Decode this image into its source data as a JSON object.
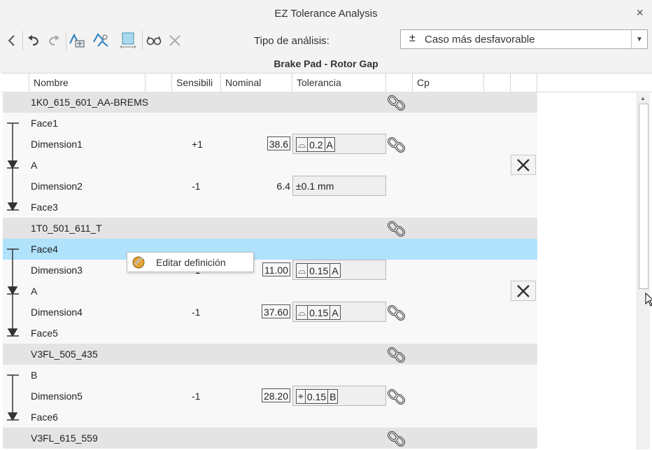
{
  "window": {
    "title": "EZ Tolerance Analysis",
    "close_glyph": "×"
  },
  "toolbar": {
    "icons": [
      "back-arrow-icon",
      "undo-icon",
      "redo-icon",
      "add-dimension-icon",
      "add-surface-icon",
      "cube-icon",
      "glasses-icon",
      "close-icon"
    ],
    "analysis_label": "Tipo de análisis:",
    "analysis_value": "Caso más desfavorable",
    "analysis_symbol": "±"
  },
  "analysis_title": "Brake Pad - Rotor Gap",
  "columns": [
    "Nombre",
    "Sensibili",
    "Nominal",
    "Tolerancia",
    "Cp"
  ],
  "rows": [
    {
      "type": "part",
      "name": "1K0_615_601_AA-BREMS",
      "link": true
    },
    {
      "type": "face",
      "name": "Face1"
    },
    {
      "type": "dim",
      "name": "Dimension1",
      "sens": "+1",
      "nominal": "38.6",
      "boxed": true,
      "tol": {
        "kind": "fcf",
        "sym": "⌓",
        "val": "0.2",
        "datum": "A"
      },
      "link": true
    },
    {
      "type": "face",
      "name": "A",
      "remove": true
    },
    {
      "type": "dim",
      "name": "Dimension2",
      "sens": "-1",
      "nominal": "6.4",
      "boxed": false,
      "tol": {
        "kind": "text",
        "text": "±0.1 mm"
      }
    },
    {
      "type": "face",
      "name": "Face3"
    },
    {
      "type": "part",
      "name": "1T0_501_611_T",
      "link": true
    },
    {
      "type": "face",
      "name": "Face4",
      "selected": true
    },
    {
      "type": "dim",
      "name": "Dimension3",
      "sens": "-1",
      "nominal": "11.00",
      "boxed": true,
      "tol": {
        "kind": "fcf",
        "sym": "⌓",
        "val": "0.15",
        "datum": "A"
      }
    },
    {
      "type": "face",
      "name": "A",
      "remove": true
    },
    {
      "type": "dim",
      "name": "Dimension4",
      "sens": "-1",
      "nominal": "37.60",
      "boxed": true,
      "tol": {
        "kind": "fcf",
        "sym": "⌓",
        "val": "0.15",
        "datum": "A"
      },
      "link": true
    },
    {
      "type": "face",
      "name": "Face5"
    },
    {
      "type": "part",
      "name": "V3FL_505_435",
      "link": true
    },
    {
      "type": "face",
      "name": "B"
    },
    {
      "type": "dim",
      "name": "Dimension5",
      "sens": "-1",
      "nominal": "28.20",
      "boxed": true,
      "tol": {
        "kind": "fcf",
        "sym": "⌖",
        "val": "0.15",
        "datum": "B"
      },
      "link": true
    },
    {
      "type": "face",
      "name": "Face6"
    },
    {
      "type": "part",
      "name": "V3FL_615_559",
      "link": true
    }
  ],
  "context_menu": {
    "label": "Editar definición"
  },
  "colors": {
    "selected_row": "#b0e2fb",
    "part_row": "#e4e4e4",
    "face_row": "#f8f8f8"
  }
}
